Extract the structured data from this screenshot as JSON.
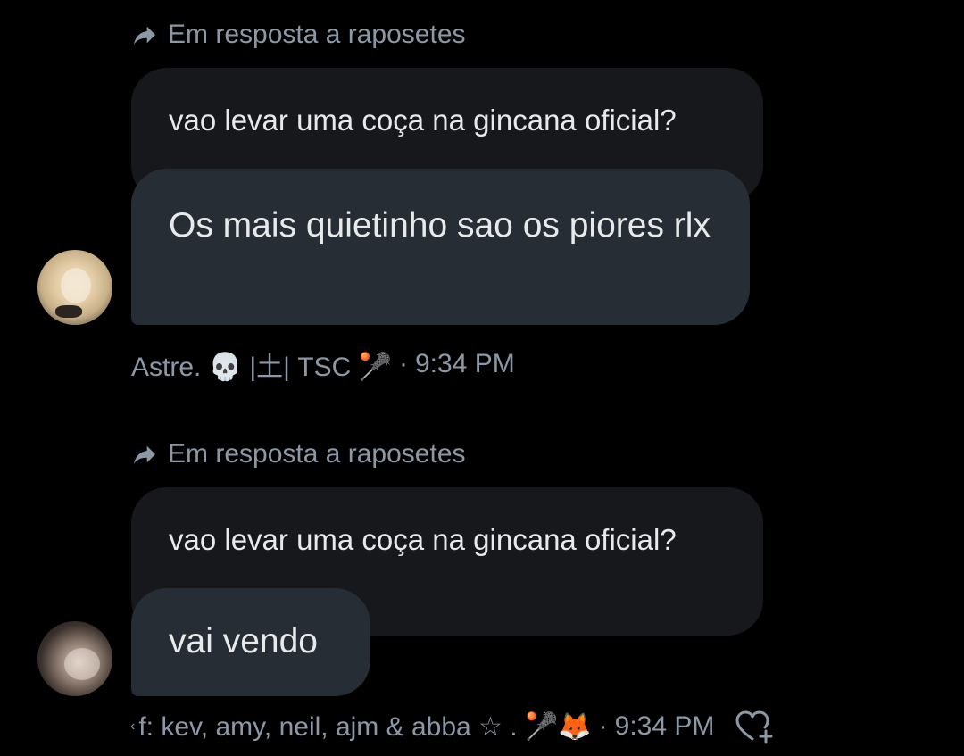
{
  "messages": [
    {
      "reply_to": "Em resposta a raposetes",
      "quoted_text": "vao levar uma coça na gincana oficial?",
      "text": "Os mais quietinho sao os piores rlx",
      "author": "Astre. 💀 |土| TSC 🥍",
      "time": "9:34 PM"
    },
    {
      "reply_to": "Em resposta a raposetes",
      "quoted_text": "vao levar uma coça na gincana oficial?",
      "text": "vai vendo",
      "author_prefix": "‹",
      "author": "f: kev, amy, neil, ajm & abba ☆ . 🥍🦊",
      "time": "9:34 PM"
    }
  ],
  "separator": "·",
  "icons": {
    "reply": "reply-arrow-icon",
    "react": "heart-plus-icon"
  },
  "colors": {
    "background": "#000000",
    "bubble": "#262d34",
    "quoted": "#16181c",
    "secondary_text": "#8b98a5"
  }
}
